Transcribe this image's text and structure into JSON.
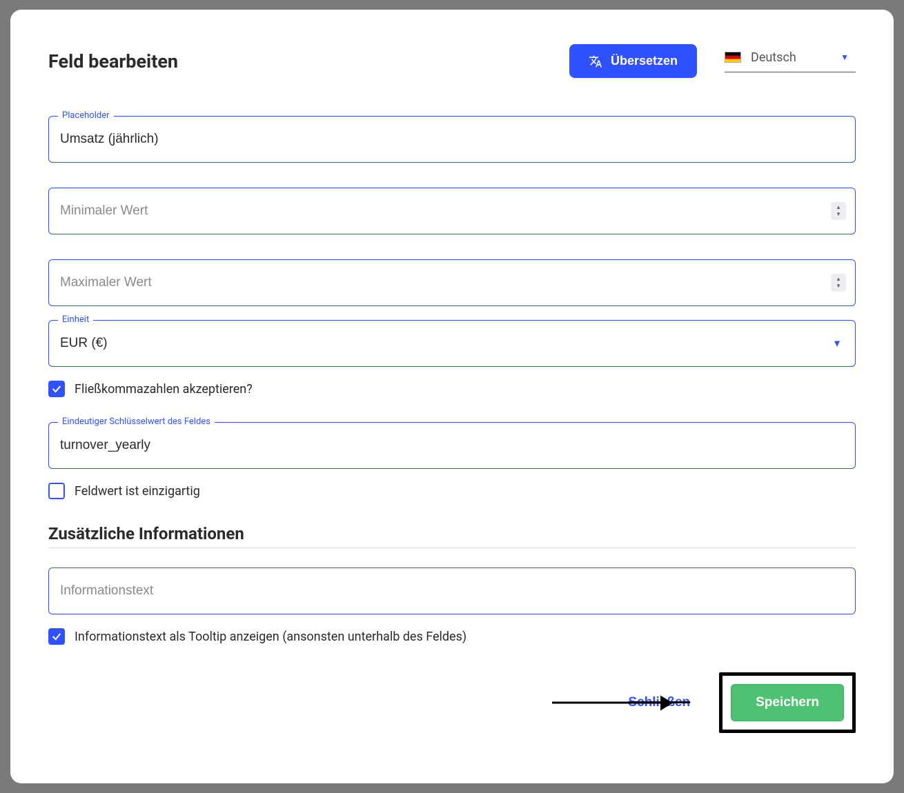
{
  "modal": {
    "title": "Feld bearbeiten",
    "translate_label": "Übersetzen",
    "language": "Deutsch"
  },
  "fields": {
    "placeholder": {
      "label": "Placeholder",
      "value": "Umsatz (jährlich)"
    },
    "min_value": {
      "placeholder": "Minimaler Wert"
    },
    "max_value": {
      "placeholder": "Maximaler Wert"
    },
    "unit": {
      "label": "Einheit",
      "value": "EUR (€)"
    },
    "accept_float": {
      "label": "Fließkommazahlen akzeptieren?",
      "checked": true
    },
    "key": {
      "label": "Eindeutiger Schlüsselwert des Feldes",
      "value": "turnover_yearly"
    },
    "unique": {
      "label": "Feldwert ist einzigartig",
      "checked": false
    }
  },
  "additional": {
    "title": "Zusätzliche Informationen",
    "info_placeholder": "Informationstext",
    "tooltip_label": "Informationstext als Tooltip anzeigen (ansonsten unterhalb des Feldes)",
    "tooltip_checked": true
  },
  "footer": {
    "close": "Schließen",
    "save": "Speichern"
  }
}
